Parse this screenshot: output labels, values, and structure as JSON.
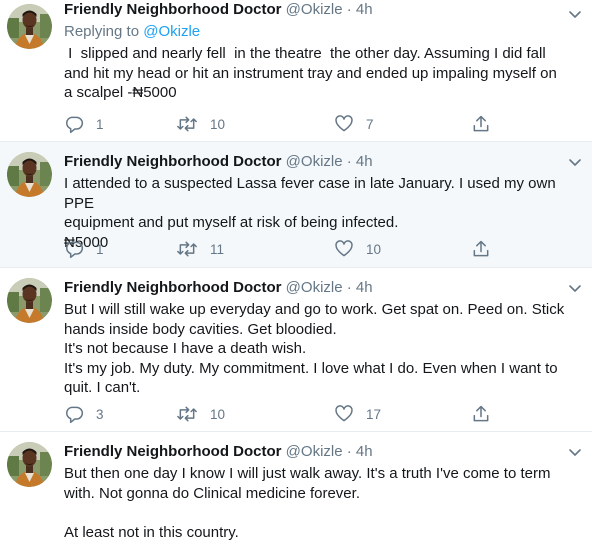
{
  "tweets": [
    {
      "name": "Friendly Neighborhood Doctor",
      "handle": "@Okizle",
      "dot": "·",
      "time": "4h",
      "replying_prefix": "Replying to ",
      "replying_to": "@Okizle",
      "text": " I  slipped and nearly fell  in the theatre  the other day. Assuming I did fall\nand hit my head or hit an instrument tray and ended up impaling myself on\na scalpel -₦5000",
      "replies": "1",
      "retweets": "10",
      "likes": "7"
    },
    {
      "name": "Friendly Neighborhood Doctor",
      "handle": "@Okizle",
      "dot": "·",
      "time": "4h",
      "text": "I attended to a suspected Lassa fever case in late January. I used my own PPE\nequipment and put myself at risk of being infected.\n₦5000",
      "replies": "1",
      "retweets": "11",
      "likes": "10"
    },
    {
      "name": "Friendly Neighborhood Doctor",
      "handle": "@Okizle",
      "dot": "·",
      "time": "4h",
      "text": "But I will still wake up everyday and go to work. Get spat on. Peed on. Stick\nhands inside body cavities. Get bloodied.\nIt's not because I have a death wish.\nIt's my job. My duty. My commitment. I love what I do. Even when I want to\nquit. I can't.",
      "replies": "3",
      "retweets": "10",
      "likes": "17"
    },
    {
      "name": "Friendly Neighborhood Doctor",
      "handle": "@Okizle",
      "dot": "·",
      "time": "4h",
      "text": "But then one day I know I will just walk away. It's a truth I've come to term\nwith. Not gonna do Clinical medicine forever.\n\nAt least not in this country."
    }
  ],
  "icons": {
    "reply": "reply-icon",
    "retweet": "retweet-icon",
    "like": "heart-icon",
    "share": "share-icon",
    "more": "chevron-down-icon"
  },
  "colors": {
    "link": "#1da1f2",
    "secondary_text": "#657786",
    "primary_text": "#14171a",
    "divider": "#e6ecf0"
  }
}
